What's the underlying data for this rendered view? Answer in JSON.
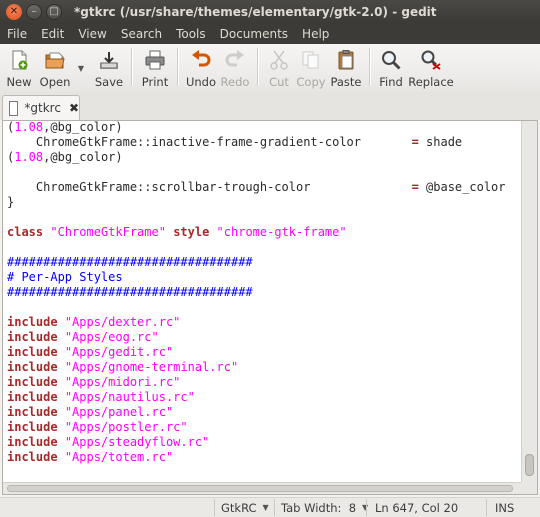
{
  "window": {
    "title": "*gtkrc (/usr/share/themes/elementary/gtk-2.0) - gedit"
  },
  "menubar": {
    "items": [
      "File",
      "Edit",
      "View",
      "Search",
      "Tools",
      "Documents",
      "Help"
    ]
  },
  "toolbar": {
    "new_label": "New",
    "open_label": "Open",
    "save_label": "Save",
    "print_label": "Print",
    "undo_label": "Undo",
    "redo_label": "Redo",
    "cut_label": "Cut",
    "copy_label": "Copy",
    "paste_label": "Paste",
    "find_label": "Find",
    "replace_label": "Replace"
  },
  "tabs": {
    "active_label": "*gtkrc",
    "close_glyph": "✖"
  },
  "editor": {
    "lines": [
      "(1.08,@bg_color)",
      "    ChromeGtkFrame::inactive-frame-gradient-color       = shade",
      "(1.08,@bg_color)",
      "",
      "    ChromeGtkFrame::scrollbar-trough-color              = @base_color",
      "}",
      "",
      "class \"ChromeGtkFrame\" style \"chrome-gtk-frame\"",
      "",
      "##################################",
      "# Per-App Styles",
      "##################################",
      "",
      "include \"Apps/dexter.rc\"",
      "include \"Apps/eog.rc\"",
      "include \"Apps/gedit.rc\"",
      "include \"Apps/gnome-terminal.rc\"",
      "include \"Apps/midori.rc\"",
      "include \"Apps/nautilus.rc\"",
      "include \"Apps/panel.rc\"",
      "include \"Apps/postler.rc\"",
      "include \"Apps/steadyflow.rc\"",
      "include \"Apps/totem.rc\""
    ]
  },
  "statusbar": {
    "language": "GtkRC",
    "tab_width": "Tab Width:  8",
    "position": "Ln 647, Col 20",
    "mode": "INS"
  },
  "colors": {
    "keyword": "#a52a2a",
    "string": "#ff00ff",
    "comment": "#0000ff"
  }
}
